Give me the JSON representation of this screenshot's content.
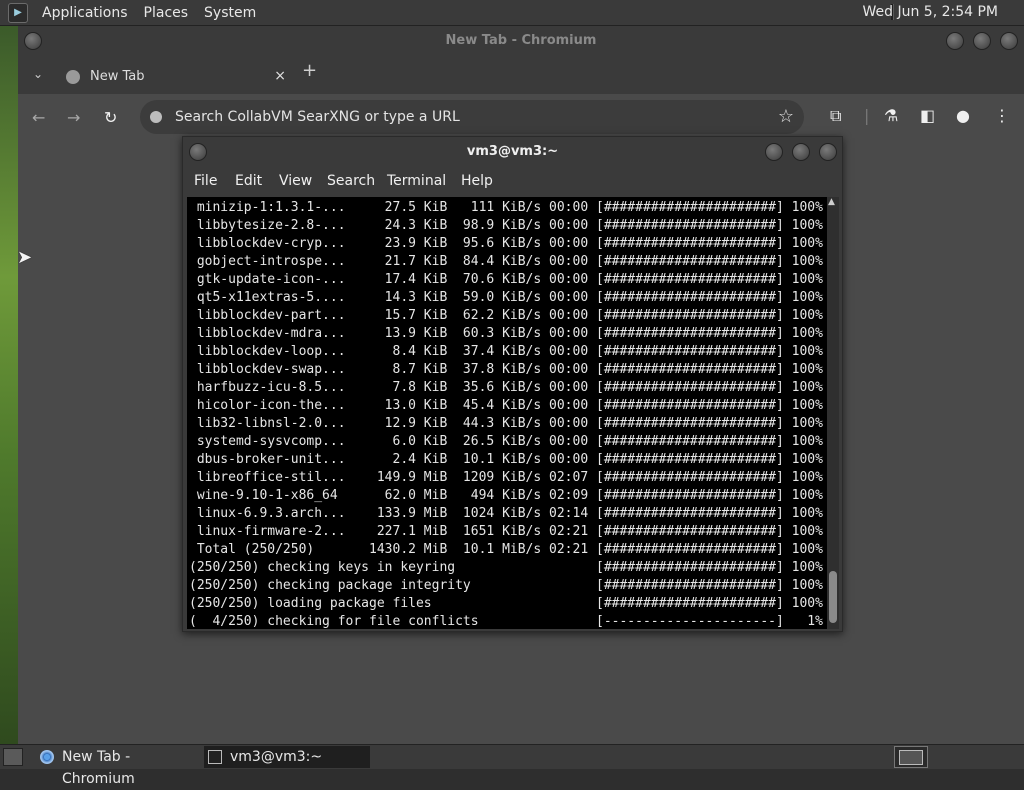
{
  "top_panel": {
    "menus": [
      "Applications",
      "Places",
      "System"
    ],
    "clock": "Wed Jun  5,  2:54 PM"
  },
  "chromium": {
    "window_title": "New Tab - Chromium",
    "tab_title": "New Tab",
    "omnibox_placeholder": "Search CollabVM SearXNG or type a URL",
    "new_tab_glyph": "+",
    "close_glyph": "×"
  },
  "terminal": {
    "window_title": "vm3@vm3:~",
    "menus": [
      "File",
      "Edit",
      "View",
      "Search",
      "Terminal",
      "Help"
    ],
    "lines": [
      " minizip-1:1.3.1-...     27.5 KiB   111 KiB/s 00:00 [######################] 100%",
      " libbytesize-2.8-...     24.3 KiB  98.9 KiB/s 00:00 [######################] 100%",
      " libblockdev-cryp...     23.9 KiB  95.6 KiB/s 00:00 [######################] 100%",
      " gobject-introspe...     21.7 KiB  84.4 KiB/s 00:00 [######################] 100%",
      " gtk-update-icon-...     17.4 KiB  70.6 KiB/s 00:00 [######################] 100%",
      " qt5-x11extras-5....     14.3 KiB  59.0 KiB/s 00:00 [######################] 100%",
      " libblockdev-part...     15.7 KiB  62.2 KiB/s 00:00 [######################] 100%",
      " libblockdev-mdra...     13.9 KiB  60.3 KiB/s 00:00 [######################] 100%",
      " libblockdev-loop...      8.4 KiB  37.4 KiB/s 00:00 [######################] 100%",
      " libblockdev-swap...      8.7 KiB  37.8 KiB/s 00:00 [######################] 100%",
      " harfbuzz-icu-8.5...      7.8 KiB  35.6 KiB/s 00:00 [######################] 100%",
      " hicolor-icon-the...     13.0 KiB  45.4 KiB/s 00:00 [######################] 100%",
      " lib32-libnsl-2.0...     12.9 KiB  44.3 KiB/s 00:00 [######################] 100%",
      " systemd-sysvcomp...      6.0 KiB  26.5 KiB/s 00:00 [######################] 100%",
      " dbus-broker-unit...      2.4 KiB  10.1 KiB/s 00:00 [######################] 100%",
      " libreoffice-stil...    149.9 MiB  1209 KiB/s 02:07 [######################] 100%",
      " wine-9.10-1-x86_64      62.0 MiB   494 KiB/s 02:09 [######################] 100%",
      " linux-6.9.3.arch...    133.9 MiB  1024 KiB/s 02:14 [######################] 100%",
      " linux-firmware-2...    227.1 MiB  1651 KiB/s 02:21 [######################] 100%",
      " Total (250/250)       1430.2 MiB  10.1 MiB/s 02:21 [######################] 100%",
      "(250/250) checking keys in keyring                  [######################] 100%",
      "(250/250) checking package integrity                [######################] 100%",
      "(250/250) loading package files                     [######################] 100%",
      "(  4/250) checking for file conflicts               [----------------------]   1%"
    ]
  },
  "taskbar": {
    "tasks": [
      {
        "label": "New Tab - Chromium",
        "icon": "chromium-icon"
      },
      {
        "label": "vm3@vm3:~",
        "icon": "terminal-icon"
      }
    ]
  },
  "colors": {
    "panel": "#3a3a3a",
    "chrome_bg": "#4a4a4a",
    "terminal_bg": "#000000",
    "terminal_fg": "#e6e6e6"
  }
}
